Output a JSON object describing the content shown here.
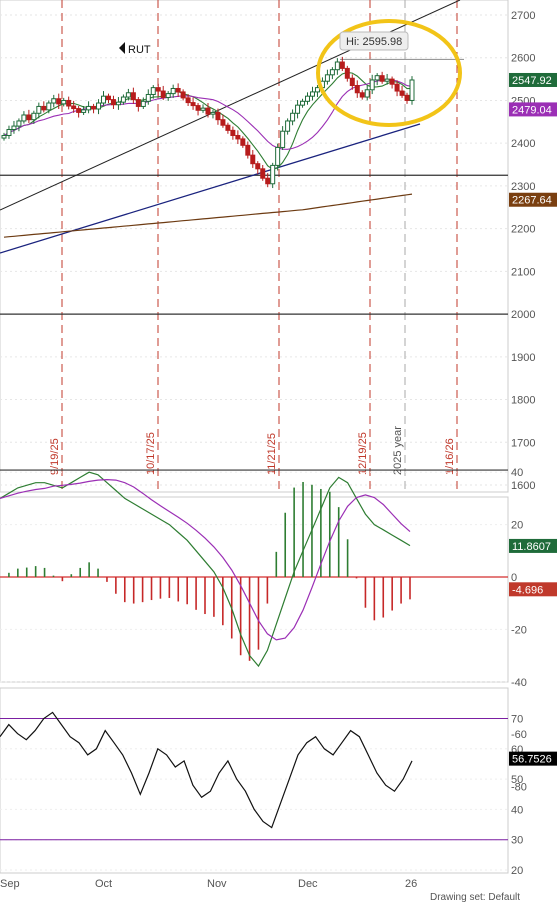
{
  "chart_data": {
    "type": "candlestick",
    "symbol": "RUT",
    "hi_label": "Hi: 2595.98",
    "price_panel": {
      "yticks": [
        1600,
        1700,
        1800,
        1900,
        2000,
        2100,
        2200,
        2300,
        2400,
        2500,
        2600,
        2700
      ],
      "badges": [
        {
          "text": "2547.92",
          "value": 2547.92,
          "color": "#1f6b3a"
        },
        {
          "text": "2479.04",
          "value": 2479.04,
          "color": "#9b2fb5"
        },
        {
          "text": "2267.64",
          "value": 2267.64,
          "color": "#7a3f10"
        }
      ],
      "hlines": [
        {
          "value": 2325,
          "color": "#333333"
        },
        {
          "value": 2000,
          "color": "#333333"
        },
        {
          "value": 1635,
          "color": "#333333"
        },
        {
          "value": 2595.98,
          "color": "#999999"
        }
      ],
      "vdates": [
        {
          "label": "9/19/25",
          "color": "#c0392b"
        },
        {
          "label": "10/17/25",
          "color": "#c0392b"
        },
        {
          "label": "11/21/25",
          "color": "#c0392b"
        },
        {
          "label": "12/19/25",
          "color": "#c0392b"
        },
        {
          "label": "2025 year",
          "color": "#aaaaaa"
        },
        {
          "label": "1/16/26",
          "color": "#c0392b"
        }
      ],
      "candles": [
        2418,
        2432,
        2440,
        2452,
        2466,
        2455,
        2470,
        2486,
        2478,
        2494,
        2504,
        2492,
        2500,
        2487,
        2481,
        2472,
        2478,
        2486,
        2480,
        2494,
        2510,
        2502,
        2490,
        2496,
        2508,
        2518,
        2502,
        2486,
        2498,
        2514,
        2530,
        2522,
        2507,
        2516,
        2528,
        2520,
        2506,
        2495,
        2488,
        2477,
        2482,
        2468,
        2472,
        2455,
        2442,
        2430,
        2418,
        2410,
        2395,
        2372,
        2352,
        2340,
        2318,
        2305,
        2348,
        2390,
        2428,
        2452,
        2470,
        2489,
        2498,
        2510,
        2520,
        2530,
        2545,
        2560,
        2572,
        2590,
        2575,
        2552,
        2535,
        2518,
        2508,
        2525,
        2548,
        2558,
        2545,
        2550,
        2538,
        2522,
        2512,
        2500,
        2547.92
      ],
      "ma_green_last": 2525,
      "ma_purple_last": 2479.04,
      "ma_blue_last": 2440,
      "ma_brown_last": 2267.64
    },
    "macd_panel": {
      "yticks": [
        -80,
        -60,
        -40,
        -20,
        0,
        20,
        40
      ],
      "badges": [
        {
          "text": "11.8607",
          "value": 11.8607,
          "color": "#1f6b3a"
        },
        {
          "text": "-4.696",
          "value": -4.696,
          "color": "#c0392b"
        }
      ]
    },
    "rsi_panel": {
      "yticks": [
        20,
        30,
        40,
        50,
        60,
        70
      ],
      "badges": [
        {
          "text": "56.7526",
          "value": 56.7526,
          "color": "#000000"
        }
      ],
      "overbought": 70,
      "oversold": 30
    },
    "xaxis": {
      "labels": [
        "Sep",
        "Oct",
        "Nov",
        "Dec",
        "26"
      ]
    }
  },
  "footer": "Drawing set: Default"
}
